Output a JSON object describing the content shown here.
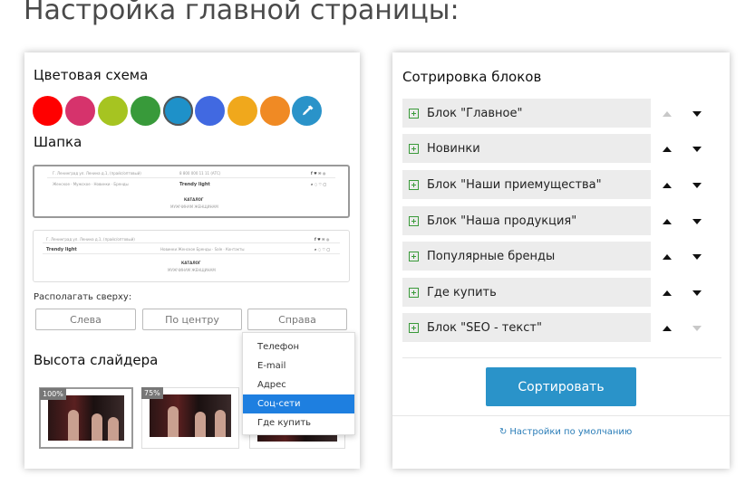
{
  "page_title": "Настройка главной страницы:",
  "left": {
    "color_scheme_title": "Цветовая схема",
    "colors": [
      {
        "name": "red",
        "hex": "#ff0000"
      },
      {
        "name": "pink",
        "hex": "#d6336c"
      },
      {
        "name": "lime",
        "hex": "#a6c421"
      },
      {
        "name": "green",
        "hex": "#389a3a"
      },
      {
        "name": "blue",
        "hex": "#1e91c9",
        "selected": true
      },
      {
        "name": "royal-blue",
        "hex": "#4169e1"
      },
      {
        "name": "yellow",
        "hex": "#f0a81c"
      },
      {
        "name": "orange",
        "hex": "#f08a24"
      }
    ],
    "picker_color": "#2a93c9",
    "header_title": "Шапка",
    "header_preview_1": {
      "left_text": "Г. Ленинград ул. Ленина д.1, (прайс/оптовый)",
      "phone": "8 800 000 11 11 (АТС)",
      "nav": "Женское · Мужское · Новинки · Бренды",
      "logo": "Trendy light",
      "catalog": "КАТАЛОГ",
      "sub": "МУЖЧИНАМ ЖЕНЩИНАМ"
    },
    "header_preview_2": {
      "left_text": "Г. Ленинград ул. Ленина д.1, (прайс/оптовый)",
      "logo": "Trendy light",
      "nav": "Новинки Женское Бренды · Sale · Контакты",
      "catalog": "КАТАЛОГ",
      "sub": "МУЖЧИНАМ ЖЕНЩИНАМ"
    },
    "position_label": "Располагать сверху:",
    "position_buttons": [
      "Слева",
      "По центру",
      "Справа"
    ],
    "dropdown_items": [
      "Телефон",
      "E-mail",
      "Адрес",
      "Соц-сети",
      "Где купить"
    ],
    "dropdown_selected_index": 3,
    "slider_height_title": "Высота слайдера",
    "slider_badges": [
      "100%",
      "75%"
    ]
  },
  "right": {
    "title": "Сотрировка блоков",
    "blocks": [
      {
        "label": "Блок \"Главное\"",
        "up_enabled": false,
        "down_enabled": true
      },
      {
        "label": "Новинки",
        "up_enabled": true,
        "down_enabled": true
      },
      {
        "label": "Блок \"Наши приемущества\"",
        "up_enabled": true,
        "down_enabled": true
      },
      {
        "label": "Блок \"Наша продукция\"",
        "up_enabled": true,
        "down_enabled": true
      },
      {
        "label": "Популярные бренды",
        "up_enabled": true,
        "down_enabled": true
      },
      {
        "label": "Где купить",
        "up_enabled": true,
        "down_enabled": true
      },
      {
        "label": "Блок \"SEO - текст\"",
        "up_enabled": true,
        "down_enabled": false
      }
    ],
    "sort_button": "Сортировать",
    "reset_link": "Настройки по умолчанию",
    "accent": "#2a93c9"
  }
}
